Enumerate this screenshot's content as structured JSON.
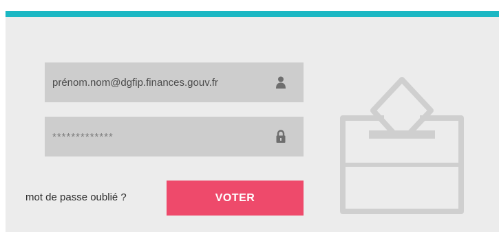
{
  "login": {
    "email_value": "prénom.nom@dgfip.finances.gouv.fr",
    "password_value": "*************",
    "forgot_password_label": "mot de passe oublié ?",
    "submit_label": "VOTER"
  },
  "icons": {
    "email_field": "user-icon",
    "password_field": "lock-icon",
    "illustration": "ballot-box-icon"
  },
  "colors": {
    "accent": "#1bb7c3",
    "panel_background": "#ececec",
    "field_background": "#cdcdcd",
    "button_background": "#ee4a6b",
    "button_text": "#ffffff",
    "illustration_stroke": "#cfcfcf"
  }
}
